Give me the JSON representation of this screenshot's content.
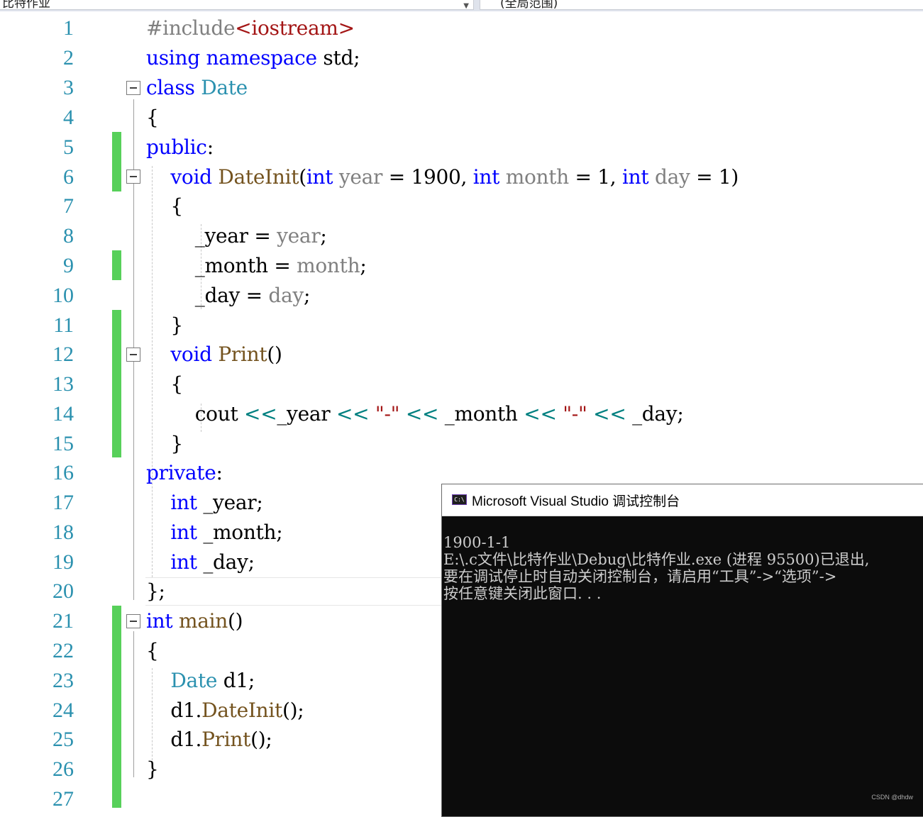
{
  "toolbar": {
    "project_dropdown": "比特作业",
    "scope_dropdown": "(全局范围)"
  },
  "editor": {
    "line_numbers": [
      "1",
      "2",
      "3",
      "4",
      "5",
      "6",
      "7",
      "8",
      "9",
      "10",
      "11",
      "12",
      "13",
      "14",
      "15",
      "16",
      "17",
      "18",
      "19",
      "20",
      "21",
      "22",
      "23",
      "24",
      "25",
      "26",
      "27"
    ]
  },
  "console": {
    "title": "Microsoft Visual Studio 调试控制台",
    "icon": "console-icon",
    "lines": [
      "1900-1-1",
      "E:\\.c文件\\比特作业\\Debug\\比特作业.exe (进程 95500)已退出,",
      "要在调试停止时自动关闭控制台，请启用“工具”->“选项”->",
      "按任意键关闭此窗口. . ."
    ]
  },
  "watermark": "CSDN @dhdw",
  "colors": {
    "keyword": "#0000ff",
    "type": "#2b91af",
    "function": "#74531f",
    "parameter": "#808080",
    "string": "#a31515",
    "change_marker": "#57d05a",
    "console_bg": "#0c0c0c"
  }
}
